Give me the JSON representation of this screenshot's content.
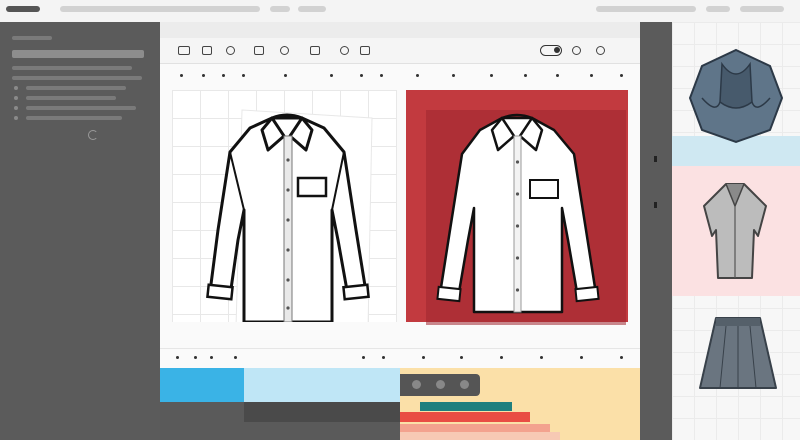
{
  "toolbar": {
    "label_left": "",
    "label_right": ""
  },
  "canvas": {
    "left_shirt": "white-shirt-outline",
    "right_shirt": "white-shirt-on-red"
  },
  "gallery": {
    "items": [
      "hood-icon",
      "vest-icon",
      "skirt-icon"
    ]
  },
  "colors": {
    "accent_red": "#c23a3f",
    "accent_blue": "#3ab3e6",
    "accent_teal": "#1f7f7e",
    "accent_yellow": "#fbe0a8",
    "sidebar": "#5b5b5b"
  }
}
